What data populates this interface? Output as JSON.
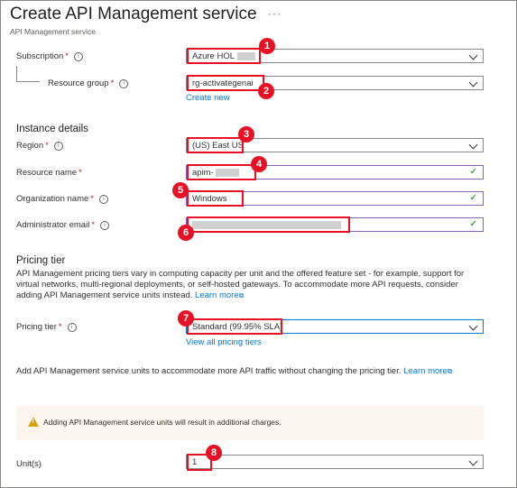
{
  "header": {
    "title": "Create API Management service",
    "more": "···",
    "subtitle": "API Management service"
  },
  "form": {
    "subscription": {
      "label": "Subscription",
      "value": "Azure HOL"
    },
    "resource_group": {
      "label": "Resource group",
      "value": "rg-activategenai",
      "create_new": "Create new"
    },
    "instance_details": "Instance details",
    "region": {
      "label": "Region",
      "value": "(US) East US"
    },
    "resource_name": {
      "label": "Resource name",
      "value": "apim-"
    },
    "organization_name": {
      "label": "Organization name",
      "value": "Windows"
    },
    "admin_email": {
      "label": "Administrator email",
      "value": ""
    },
    "pricing_section": "Pricing tier",
    "pricing_description": "API Management pricing tiers vary in computing capacity per unit and the offered feature set - for example, support for virtual networks, multi-regional deployments, or self-hosted gateways. To accommodate more API requests, consider adding API Management service units instead.",
    "pricing_learn_more": "Learn more",
    "pricing_tier": {
      "label": "Pricing tier",
      "value": "Standard (99.95% SLA)",
      "view_all": "View all pricing tiers"
    },
    "units_description": "Add API Management service units to accommodate more API traffic without changing the pricing tier.",
    "units_learn_more": "Learn more",
    "warning": "Adding API Management service units will result in additional charges.",
    "units": {
      "label": "Unit(s)",
      "value": "1"
    },
    "required_mark": "*",
    "info_glyph": "i",
    "check_glyph": "✓",
    "external_glyph": "⧉"
  },
  "callouts": [
    "1",
    "2",
    "3",
    "4",
    "5",
    "6",
    "7",
    "8"
  ],
  "colors": {
    "highlight": "#e81123",
    "link": "#0078d4",
    "valid_border": "#8764b8",
    "check": "#107c10"
  },
  "icons": [
    "info-icon",
    "chevron-down-icon",
    "checkmark-icon",
    "external-link-icon",
    "warning-icon"
  ]
}
